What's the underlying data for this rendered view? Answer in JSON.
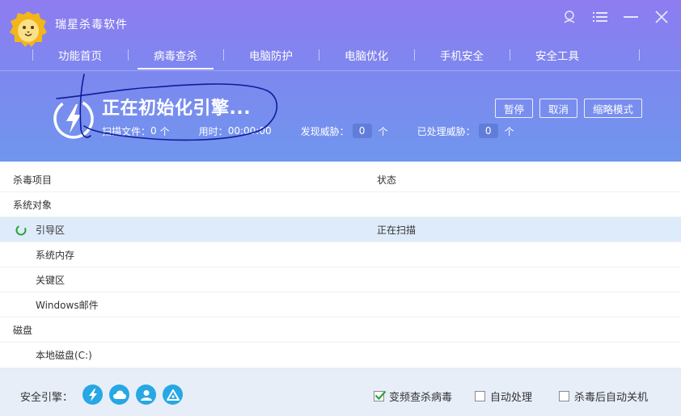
{
  "app": {
    "title": "瑞星杀毒软件"
  },
  "tabs": [
    {
      "label": "功能首页"
    },
    {
      "label": "病毒查杀"
    },
    {
      "label": "电脑防护"
    },
    {
      "label": "电脑优化"
    },
    {
      "label": "手机安全"
    },
    {
      "label": "安全工具"
    }
  ],
  "active_tab": 1,
  "scan": {
    "title": "正在初始化引擎...",
    "files_label": "扫描文件：",
    "files_value": "0",
    "files_unit": "个",
    "time_label": "用时：",
    "time_value": "00:00:00",
    "threats_label": "发现威胁：",
    "threats_value": "0",
    "threats_unit": "个",
    "handled_label": "已处理威胁：",
    "handled_value": "0",
    "handled_unit": "个"
  },
  "buttons": {
    "pause": "暂停",
    "cancel": "取消",
    "mini": "缩略模式"
  },
  "table": {
    "col_item": "杀毒项目",
    "col_status": "状态",
    "rows": [
      {
        "label": "系统对象",
        "status": "",
        "kind": "group"
      },
      {
        "label": "引导区",
        "status": "正在扫描",
        "kind": "active"
      },
      {
        "label": "系统内存",
        "status": "",
        "kind": "item"
      },
      {
        "label": "关键区",
        "status": "",
        "kind": "item"
      },
      {
        "label": "Windows邮件",
        "status": "",
        "kind": "item"
      },
      {
        "label": "磁盘",
        "status": "",
        "kind": "group"
      },
      {
        "label": "本地磁盘(C:)",
        "status": "",
        "kind": "item"
      }
    ]
  },
  "footer": {
    "engine_label": "安全引擎：",
    "engines": [
      "lightning-engine-icon",
      "cloud-engine-icon",
      "user-engine-icon",
      "recycle-engine-icon"
    ],
    "options": [
      {
        "label": "变频查杀病毒",
        "checked": true
      },
      {
        "label": "自动处理",
        "checked": false
      },
      {
        "label": "杀毒后自动关机",
        "checked": false
      }
    ]
  },
  "colors": {
    "accent": "#7f86ef",
    "engine": "#27a7e3",
    "check": "#2aa43a",
    "row_active": "#deebfb"
  }
}
